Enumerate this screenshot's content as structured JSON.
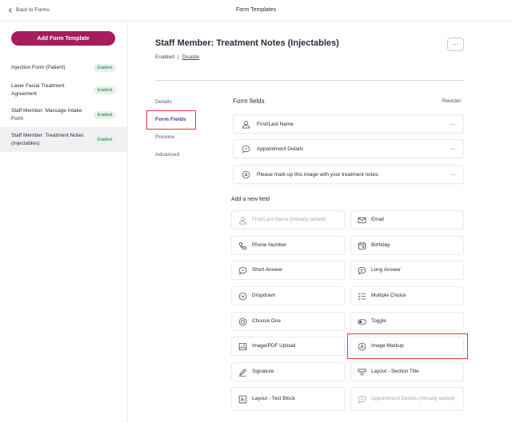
{
  "topbar": {
    "back_label": "Back to Forms",
    "title": "Form Templates"
  },
  "sidebar": {
    "add_button": "Add Form Template",
    "templates": [
      {
        "name": "Injection Form (Patient)",
        "badge": "Enabled"
      },
      {
        "name": "Laser Facial Treatment Agreement",
        "badge": "Enabled"
      },
      {
        "name": "Staff Member: Massage Intake Form",
        "badge": "Enabled"
      },
      {
        "name": "Staff Member: Treatment Notes (Injectables)",
        "badge": "Enabled"
      }
    ]
  },
  "form": {
    "title": "Staff Member: Treatment Notes (Injectables)",
    "status": "Enabled",
    "separator": "|",
    "disable_label": "Disable",
    "more_label": "···"
  },
  "subnav": {
    "items": [
      {
        "label": "Details"
      },
      {
        "label": "Form Fields"
      },
      {
        "label": "Preview"
      },
      {
        "label": "Advanced"
      }
    ],
    "active": "Form Fields"
  },
  "fields_section": {
    "title": "Form fields",
    "reorder_label": "Reorder",
    "fields": [
      {
        "label": "First/Last Name",
        "icon": "person-icon"
      },
      {
        "label": "Appointment Details",
        "icon": "chat-bubble-icon"
      },
      {
        "label": "Please mark up this image with your treatment notes:",
        "icon": "markup-icon"
      }
    ],
    "dots": "···"
  },
  "add_section": {
    "title": "Add a new field",
    "options": [
      {
        "label": "First/Last Name (Already added)",
        "icon": "person-icon",
        "disabled": true
      },
      {
        "label": "Email",
        "icon": "mail-icon",
        "disabled": false
      },
      {
        "label": "Phone Number",
        "icon": "phone-icon",
        "disabled": false
      },
      {
        "label": "Birthday",
        "icon": "calendar-icon",
        "disabled": false
      },
      {
        "label": "Short Answer",
        "icon": "chat-bubble-icon",
        "disabled": false
      },
      {
        "label": "Long Answer",
        "icon": "chat-lines-icon",
        "disabled": false
      },
      {
        "label": "Dropdown",
        "icon": "chevron-circle-icon",
        "disabled": false
      },
      {
        "label": "Multiple Choice",
        "icon": "checklist-icon",
        "disabled": false
      },
      {
        "label": "Choose One",
        "icon": "radio-icon",
        "disabled": false
      },
      {
        "label": "Toggle",
        "icon": "toggle-icon",
        "disabled": false
      },
      {
        "label": "Image/PDF Upload",
        "icon": "image-icon",
        "disabled": false
      },
      {
        "label": "Image Markup",
        "icon": "markup-icon",
        "disabled": false
      },
      {
        "label": "Signature",
        "icon": "pen-icon",
        "disabled": false
      },
      {
        "label": "Layout - Section Title",
        "icon": "section-title-icon",
        "disabled": false
      },
      {
        "label": "Layout - Text Block",
        "icon": "text-block-icon",
        "disabled": false
      },
      {
        "label": "Appointment Details (Already added)",
        "icon": "chat-bubble-icon",
        "disabled": true
      }
    ]
  },
  "colors": {
    "brand": "#a41d5f",
    "highlight": "#e0383e",
    "active_nav": "#3f3fa8",
    "badge_bg": "#e3f4ea"
  }
}
